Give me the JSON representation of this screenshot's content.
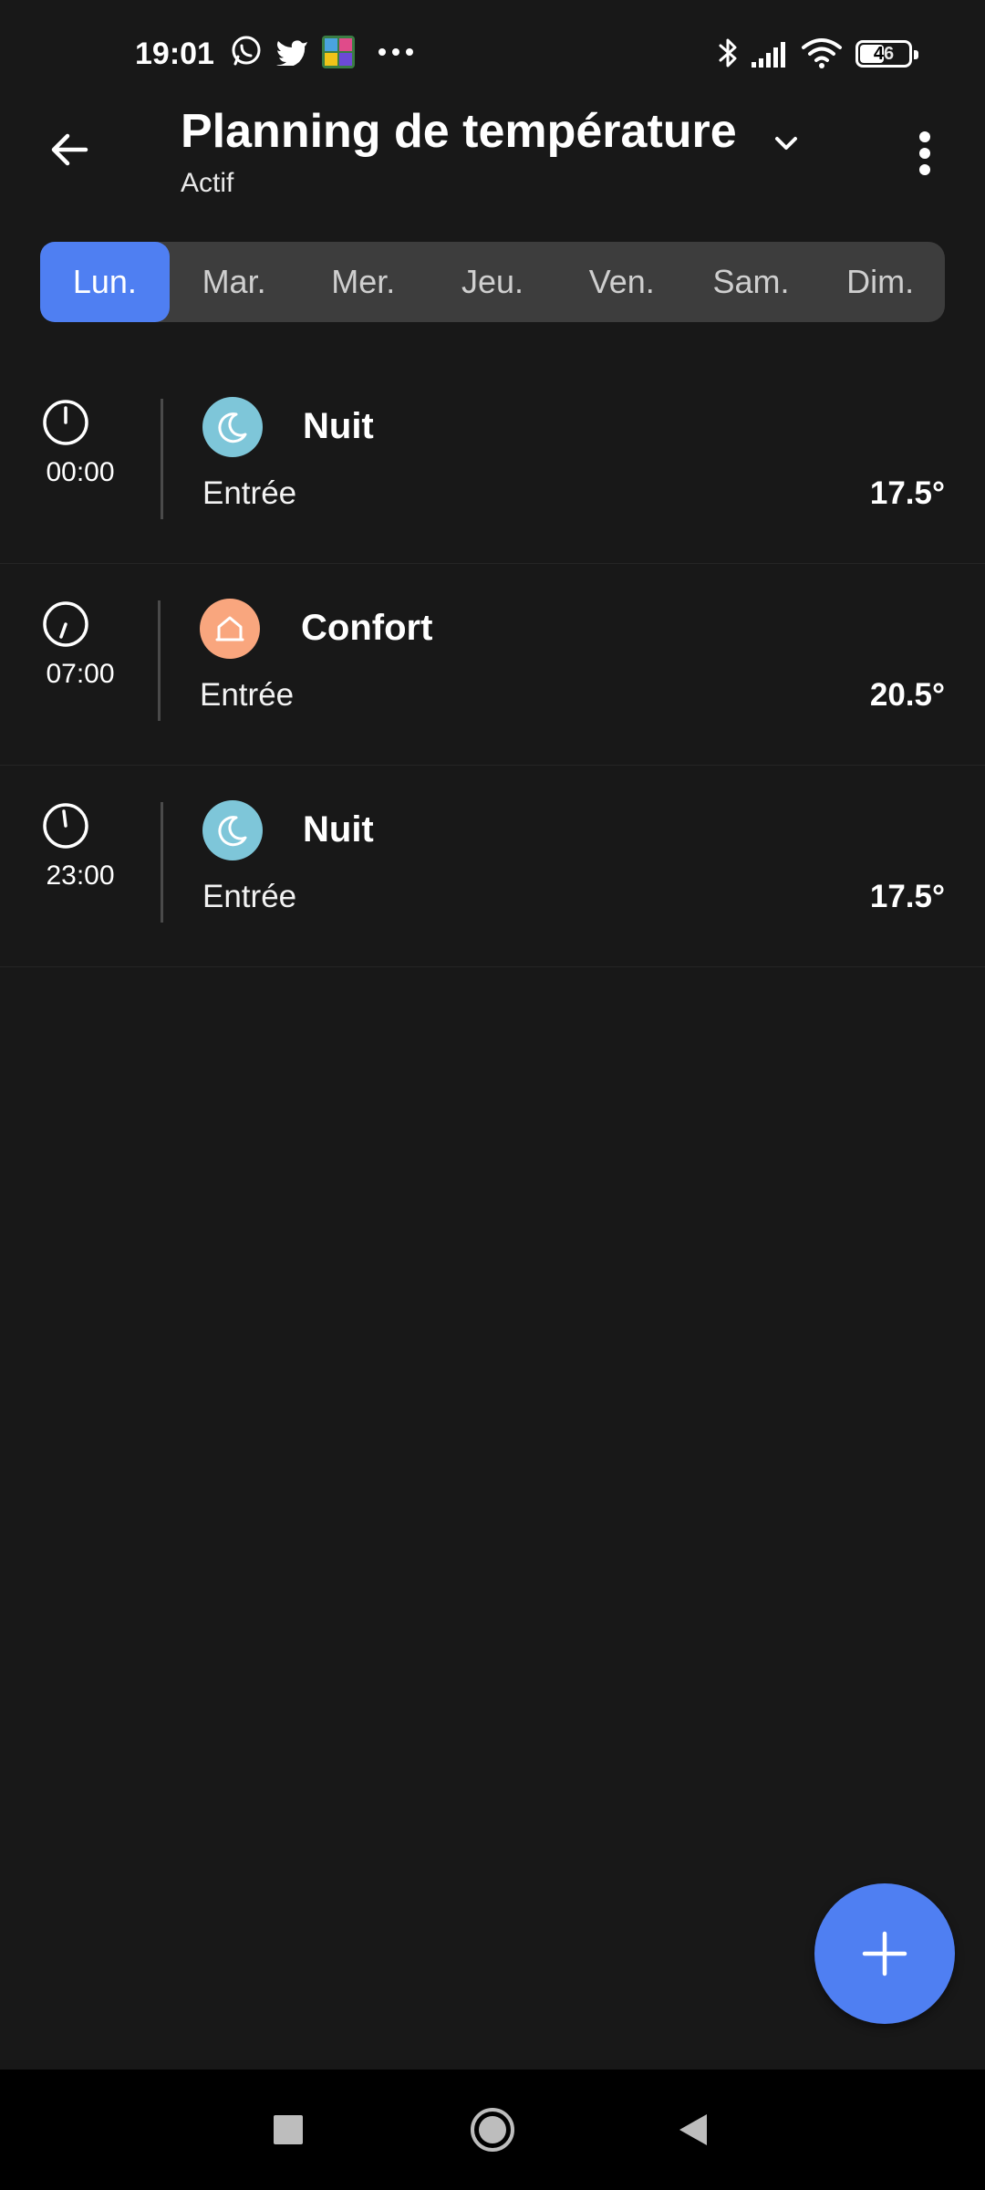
{
  "status_bar": {
    "time": "19:01",
    "left_icons": [
      "whatsapp-icon",
      "twitter-icon",
      "app-icon",
      "more-dots-icon"
    ],
    "right_icons": [
      "bluetooth-icon",
      "signal-icon",
      "wifi-icon",
      "battery-icon"
    ],
    "battery_level": "46"
  },
  "app_bar": {
    "title": "Planning de température",
    "subtitle": "Actif",
    "back_icon": "back-arrow-icon",
    "dropdown_icon": "chevron-down-icon",
    "menu_icon": "more-vertical-icon"
  },
  "days": [
    {
      "label": "Lun.",
      "active": true
    },
    {
      "label": "Mar.",
      "active": false
    },
    {
      "label": "Mer.",
      "active": false
    },
    {
      "label": "Jeu.",
      "active": false
    },
    {
      "label": "Ven.",
      "active": false
    },
    {
      "label": "Sam.",
      "active": false
    },
    {
      "label": "Dim.",
      "active": false
    }
  ],
  "schedule": [
    {
      "time": "00:00",
      "mode": "Nuit",
      "mode_icon": "moon-icon",
      "mode_color": "#7ec6d9",
      "zone": "Entrée",
      "temperature": "17.5°"
    },
    {
      "time": "07:00",
      "mode": "Confort",
      "mode_icon": "home-icon",
      "mode_color": "#f9a67e",
      "zone": "Entrée",
      "temperature": "20.5°"
    },
    {
      "time": "23:00",
      "mode": "Nuit",
      "mode_icon": "moon-icon",
      "mode_color": "#7ec6d9",
      "zone": "Entrée",
      "temperature": "17.5°"
    }
  ],
  "fab": {
    "icon": "plus-icon"
  },
  "colors": {
    "accent": "#4f7ff2",
    "background": "#181818",
    "tab_background": "#3d3d3d",
    "night": "#7ec6d9",
    "comfort": "#f9a67e"
  },
  "nav_bar": {
    "icons": [
      "recents-square-icon",
      "home-circle-icon",
      "back-triangle-icon"
    ]
  }
}
